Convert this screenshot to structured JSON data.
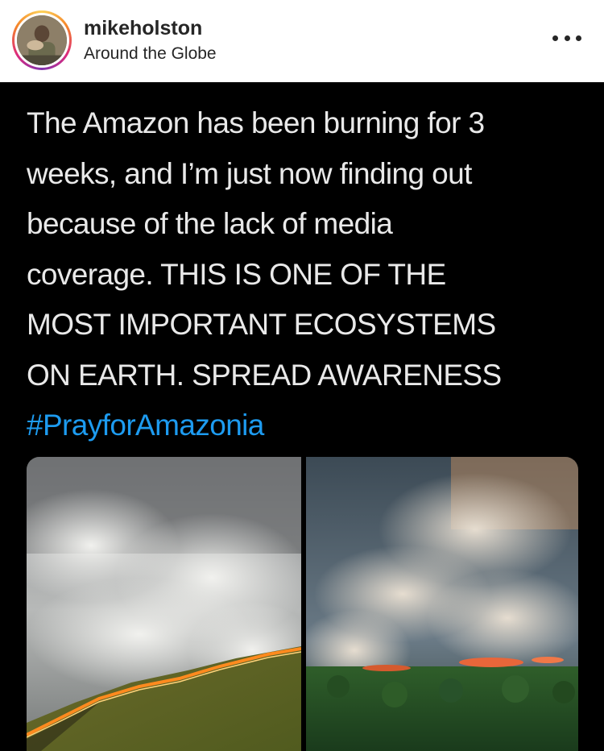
{
  "post": {
    "username": "mikeholston",
    "location": "Around the Globe"
  },
  "tweet": {
    "lines": [
      "The Amazon has been burning for 3",
      "weeks, and I’m just now finding out",
      "because of the lack of media",
      "coverage. THIS IS ONE OF THE",
      "MOST IMPORTANT ECOSYSTEMS",
      "ON EARTH. SPREAD AWARENESS"
    ],
    "hashtag": "#PrayforAmazonia"
  },
  "icons": {
    "more": "more-options-icon",
    "avatar": "profile-avatar"
  },
  "colors": {
    "hashtag": "#1d9bf0",
    "text": "#e9e9e9",
    "header_bg": "#ffffff",
    "username": "#262626"
  }
}
